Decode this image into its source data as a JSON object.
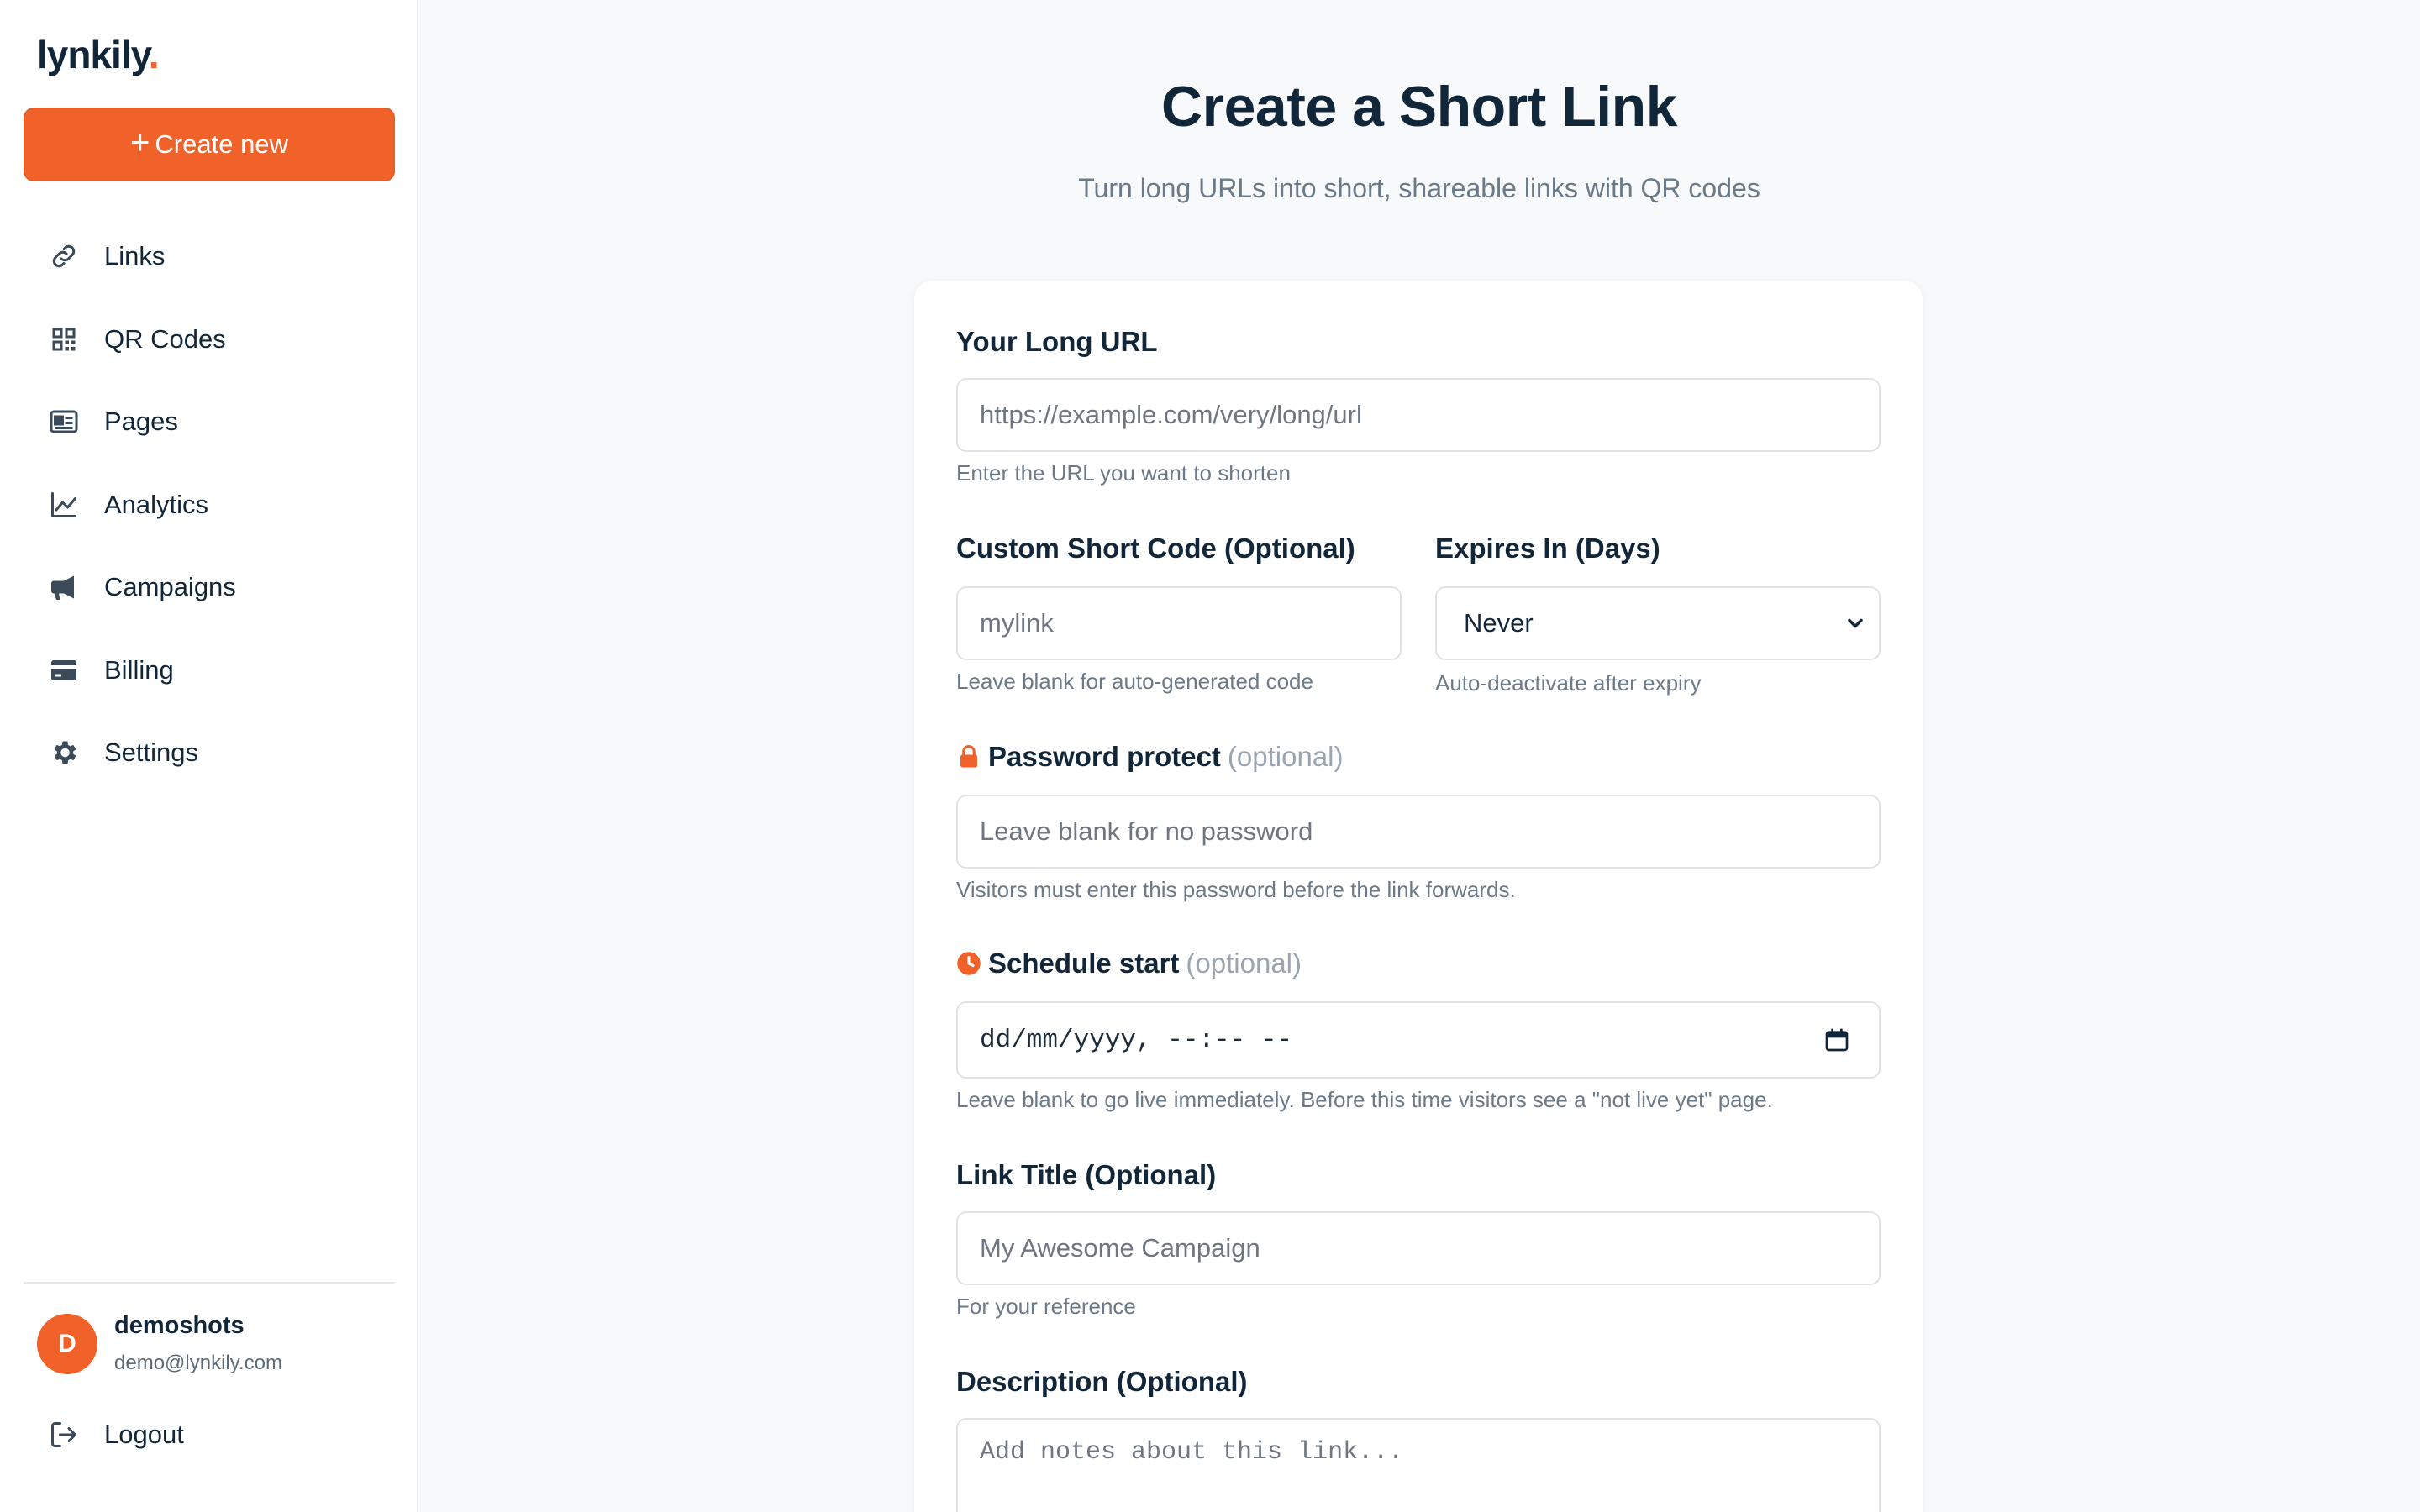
{
  "brand": {
    "name": "lynkily",
    "dot": "."
  },
  "sidebar": {
    "create_label": "Create new",
    "items": [
      {
        "label": "Links",
        "icon": "link-icon"
      },
      {
        "label": "QR Codes",
        "icon": "qr-code-icon"
      },
      {
        "label": "Pages",
        "icon": "pages-icon"
      },
      {
        "label": "Analytics",
        "icon": "chart-line-icon"
      },
      {
        "label": "Campaigns",
        "icon": "megaphone-icon"
      },
      {
        "label": "Billing",
        "icon": "credit-card-icon"
      },
      {
        "label": "Settings",
        "icon": "gear-icon"
      }
    ],
    "user": {
      "initial": "D",
      "name": "demoshots",
      "email": "demo@lynkily.com"
    },
    "logout_label": "Logout"
  },
  "page": {
    "title": "Create a Short Link",
    "subtitle": "Turn long URLs into short, shareable links with QR codes"
  },
  "form": {
    "long_url": {
      "label": "Your Long URL",
      "placeholder": "https://example.com/very/long/url",
      "help": "Enter the URL you want to shorten"
    },
    "short_code": {
      "label": "Custom Short Code (Optional)",
      "placeholder": "mylink",
      "help": "Leave blank for auto-generated code"
    },
    "expires": {
      "label": "Expires In (Days)",
      "value": "Never",
      "help": "Auto-deactivate after expiry"
    },
    "password": {
      "label": "Password protect",
      "optional": "(optional)",
      "placeholder": "Leave blank for no password",
      "help": "Visitors must enter this password before the link forwards."
    },
    "schedule": {
      "label": "Schedule start",
      "optional": "(optional)",
      "placeholder": "dd/mm/yyyy, --:-- --",
      "help": "Leave blank to go live immediately. Before this time visitors see a \"not live yet\" page."
    },
    "link_title": {
      "label": "Link Title (Optional)",
      "placeholder": "My Awesome Campaign",
      "help": "For your reference"
    },
    "description": {
      "label": "Description (Optional)",
      "placeholder": "Add notes about this link..."
    }
  },
  "colors": {
    "accent": "#f0622a",
    "text": "#12263a",
    "muted": "#6b7a89"
  }
}
